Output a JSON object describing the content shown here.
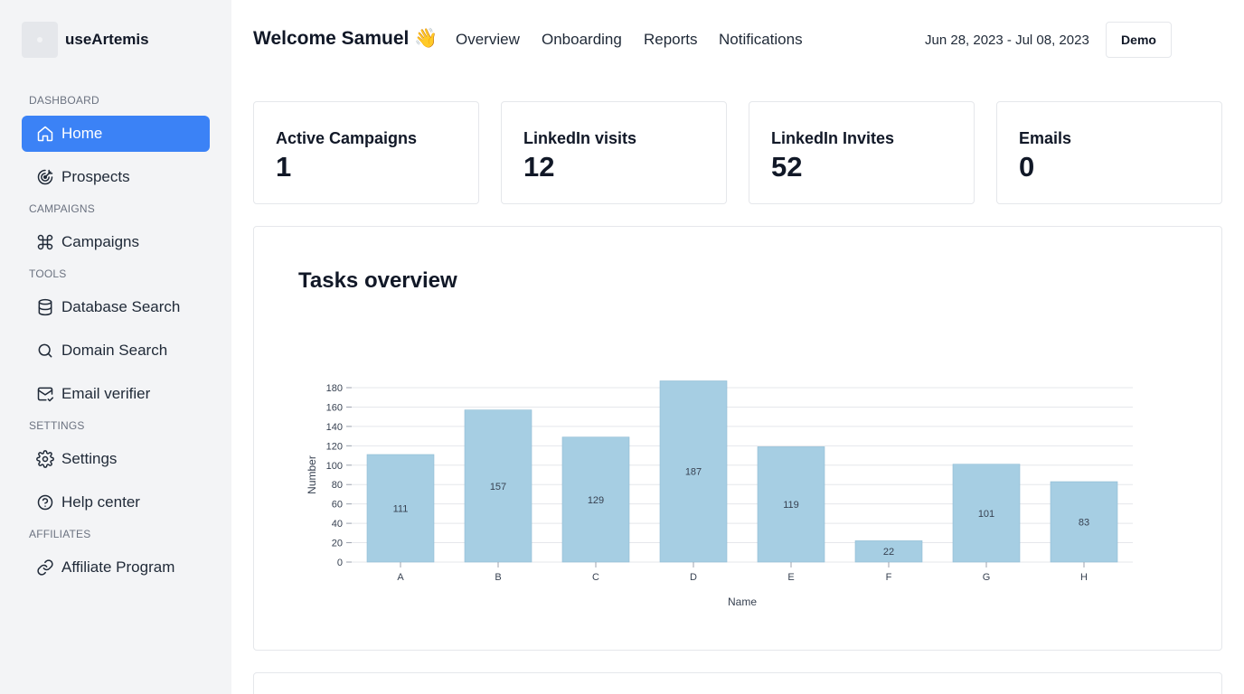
{
  "sidebar": {
    "brand": "useArtemis",
    "sections": {
      "dashboard": "DASHBOARD",
      "campaigns": "CAMPAIGNS",
      "tools": "TOOLS",
      "settings": "SETTINGS",
      "affiliates": "AFFILIATES"
    },
    "items": {
      "home": {
        "label": "Home",
        "icon": "home-icon"
      },
      "prospects": {
        "label": "Prospects",
        "icon": "target-icon"
      },
      "campaigns": {
        "label": "Campaigns",
        "icon": "command-icon"
      },
      "database_search": {
        "label": "Database Search",
        "icon": "database-icon"
      },
      "domain_search": {
        "label": "Domain Search",
        "icon": "search-icon"
      },
      "email_verifier": {
        "label": "Email verifier",
        "icon": "mail-check-icon"
      },
      "settings": {
        "label": "Settings",
        "icon": "gear-icon"
      },
      "help_center": {
        "label": "Help center",
        "icon": "help-circle-icon"
      },
      "affiliate_program": {
        "label": "Affiliate Program",
        "icon": "link-icon"
      }
    },
    "active_color": "#3b82f6"
  },
  "header": {
    "welcome": "Welcome Samuel 👋",
    "tabs": {
      "overview": "Overview",
      "onboarding": "Onboarding",
      "reports": "Reports",
      "notifications": "Notifications"
    },
    "date_range": "Jun 28, 2023 - Jul 08, 2023",
    "demo_button": "Demo"
  },
  "stats": {
    "active_campaigns": {
      "label": "Active Campaigns",
      "value": "1"
    },
    "linkedin_visits": {
      "label": "LinkedIn visits",
      "value": "12"
    },
    "linkedin_invites": {
      "label": "LinkedIn Invites",
      "value": "52"
    },
    "emails": {
      "label": "Emails",
      "value": "0"
    }
  },
  "chart_card": {
    "title": "Tasks overview"
  },
  "chart_data": {
    "type": "bar",
    "categories": [
      "A",
      "B",
      "C",
      "D",
      "E",
      "F",
      "G",
      "H"
    ],
    "values": [
      111,
      157,
      129,
      187,
      119,
      22,
      101,
      83
    ],
    "xlabel": "Name",
    "ylabel": "Number",
    "ylim": [
      0,
      180
    ],
    "yticks": [
      0,
      20,
      40,
      60,
      80,
      100,
      120,
      140,
      160,
      180
    ],
    "grid": true,
    "data_labels": true,
    "bar_color": "#a6cee3"
  }
}
